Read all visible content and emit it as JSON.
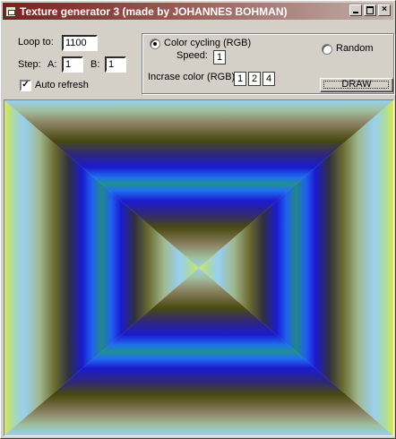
{
  "window": {
    "title": "Texture generator 3 (made by JOHANNES BOHMAN)",
    "buttons": [
      "minimize",
      "maximize",
      "close"
    ],
    "close_glyph": "×"
  },
  "controls": {
    "loop_label": "Loop to:",
    "loop_value": "1100",
    "step_label": "Step:",
    "a_label": "A:",
    "a_value": "1",
    "b_label": "B:",
    "b_value": "1",
    "auto_refresh_label": "Auto refresh",
    "auto_refresh_checked": true,
    "check_glyph": "✓"
  },
  "mode_frame": {
    "color_cycling_label": "Color cycling (RGB)",
    "color_cycling_selected": true,
    "speed_label": "Speed:",
    "speed_value": "1",
    "random_label": "Random",
    "random_selected": false,
    "increase_label": "Incrase color (RGB)",
    "increase_values": [
      "1",
      "2",
      "4"
    ],
    "draw_label": "DRAW"
  },
  "canvas": {
    "pattern": "concentric rectangular color-cycle gradient",
    "colors_outer_to_inner": [
      "#c8e860",
      "#98d8f0",
      "#b0c8b8",
      "#8a8060",
      "#4a4a10",
      "#303070",
      "#1010b0",
      "#2040f0",
      "#1a88e8",
      "#209090"
    ]
  }
}
